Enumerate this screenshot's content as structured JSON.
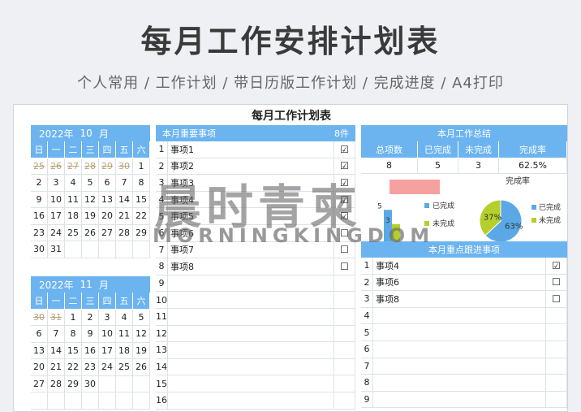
{
  "header": {
    "title": "每月工作安排计划表",
    "subtitle": "个人常用 / 工作计划 / 带日历版工作计划 / 完成进度 / A4打印"
  },
  "sheet": {
    "title": "每月工作计划表"
  },
  "weekdays": [
    "日",
    "一",
    "二",
    "三",
    "四",
    "五",
    "六"
  ],
  "calendars": [
    {
      "year": "2022年",
      "month": "10",
      "month_unit": "月",
      "weeks": [
        [
          {
            "d": "25",
            "p": true
          },
          {
            "d": "26",
            "p": true
          },
          {
            "d": "27",
            "p": true
          },
          {
            "d": "28",
            "p": true
          },
          {
            "d": "29",
            "p": true
          },
          {
            "d": "30",
            "p": true
          },
          {
            "d": "1"
          }
        ],
        [
          {
            "d": "2"
          },
          {
            "d": "3"
          },
          {
            "d": "4"
          },
          {
            "d": "5"
          },
          {
            "d": "6"
          },
          {
            "d": "7"
          },
          {
            "d": "8"
          }
        ],
        [
          {
            "d": "9"
          },
          {
            "d": "10"
          },
          {
            "d": "11"
          },
          {
            "d": "12"
          },
          {
            "d": "13"
          },
          {
            "d": "14"
          },
          {
            "d": "15"
          }
        ],
        [
          {
            "d": "16"
          },
          {
            "d": "17"
          },
          {
            "d": "18"
          },
          {
            "d": "19"
          },
          {
            "d": "20"
          },
          {
            "d": "21"
          },
          {
            "d": "22"
          }
        ],
        [
          {
            "d": "23"
          },
          {
            "d": "24"
          },
          {
            "d": "25"
          },
          {
            "d": "26"
          },
          {
            "d": "27"
          },
          {
            "d": "28"
          },
          {
            "d": "29"
          }
        ],
        [
          {
            "d": "30"
          },
          {
            "d": "31"
          },
          {
            "d": ""
          },
          {
            "d": ""
          },
          {
            "d": ""
          },
          {
            "d": ""
          },
          {
            "d": ""
          }
        ]
      ]
    },
    {
      "year": "2022年",
      "month": "11",
      "month_unit": "月",
      "weeks": [
        [
          {
            "d": "30",
            "p": true
          },
          {
            "d": "31",
            "p": true
          },
          {
            "d": "1"
          },
          {
            "d": "2"
          },
          {
            "d": "3"
          },
          {
            "d": "4"
          },
          {
            "d": "5"
          }
        ],
        [
          {
            "d": "6"
          },
          {
            "d": "7"
          },
          {
            "d": "8"
          },
          {
            "d": "9"
          },
          {
            "d": "10"
          },
          {
            "d": "11"
          },
          {
            "d": "12"
          }
        ],
        [
          {
            "d": "13"
          },
          {
            "d": "14"
          },
          {
            "d": "15"
          },
          {
            "d": "16"
          },
          {
            "d": "17"
          },
          {
            "d": "18"
          },
          {
            "d": "19"
          }
        ],
        [
          {
            "d": "20"
          },
          {
            "d": "21"
          },
          {
            "d": "22"
          },
          {
            "d": "23"
          },
          {
            "d": "24"
          },
          {
            "d": "25"
          },
          {
            "d": "26"
          }
        ],
        [
          {
            "d": "27"
          },
          {
            "d": "28"
          },
          {
            "d": "29"
          },
          {
            "d": "30"
          },
          {
            "d": ""
          },
          {
            "d": ""
          },
          {
            "d": ""
          }
        ],
        [
          {
            "d": ""
          },
          {
            "d": ""
          },
          {
            "d": ""
          },
          {
            "d": ""
          },
          {
            "d": ""
          },
          {
            "d": ""
          },
          {
            "d": ""
          }
        ]
      ]
    }
  ],
  "tasks": {
    "title": "本月重要事项",
    "count": "8件",
    "rows": [
      {
        "n": "1",
        "t": "事项1",
        "c": "☑"
      },
      {
        "n": "2",
        "t": "事项2",
        "c": "☑"
      },
      {
        "n": "3",
        "t": "事项3",
        "c": "☑"
      },
      {
        "n": "4",
        "t": "事项4",
        "c": "☑"
      },
      {
        "n": "5",
        "t": "事项5",
        "c": "☑"
      },
      {
        "n": "6",
        "t": "事项6",
        "c": "☐"
      },
      {
        "n": "7",
        "t": "事项7",
        "c": "☐"
      },
      {
        "n": "8",
        "t": "事项8",
        "c": "☐"
      },
      {
        "n": "9",
        "t": "",
        "c": ""
      },
      {
        "n": "10",
        "t": "",
        "c": ""
      },
      {
        "n": "11",
        "t": "",
        "c": ""
      },
      {
        "n": "12",
        "t": "",
        "c": ""
      },
      {
        "n": "13",
        "t": "",
        "c": ""
      },
      {
        "n": "14",
        "t": "",
        "c": ""
      },
      {
        "n": "15",
        "t": "",
        "c": ""
      },
      {
        "n": "16",
        "t": "",
        "c": ""
      }
    ]
  },
  "summary": {
    "title": "本月工作总结",
    "headers": [
      "总项数",
      "已完成",
      "未完成",
      "完成率"
    ],
    "values": [
      "8",
      "5",
      "3",
      "62.5%"
    ]
  },
  "chart_data": [
    {
      "type": "bar",
      "categories": [
        ""
      ],
      "series": [
        {
          "name": "已完成",
          "values": [
            5
          ]
        },
        {
          "name": "未完成",
          "values": [
            3
          ]
        }
      ],
      "data_labels": [
        "5",
        "3"
      ],
      "colors": [
        "#5aa9e6",
        "#b5cf2b"
      ],
      "legend": "right"
    },
    {
      "type": "pie",
      "title": "完成率",
      "labels": [
        "已完成",
        "未完成"
      ],
      "values": [
        63,
        37
      ],
      "data_labels": [
        "63%",
        "37%"
      ],
      "colors": [
        "#5aa9e6",
        "#b5cf2b"
      ],
      "legend": "right"
    }
  ],
  "followup": {
    "title": "本月重点跟进事项",
    "rows": [
      {
        "n": "1",
        "t": "事项4",
        "c": "☑"
      },
      {
        "n": "2",
        "t": "事项6",
        "c": "☐"
      },
      {
        "n": "3",
        "t": "事项8",
        "c": "☐"
      },
      {
        "n": "4",
        "t": "",
        "c": ""
      },
      {
        "n": "5",
        "t": "",
        "c": ""
      },
      {
        "n": "6",
        "t": "",
        "c": ""
      },
      {
        "n": "7",
        "t": "",
        "c": ""
      },
      {
        "n": "8",
        "t": "",
        "c": ""
      },
      {
        "n": "9",
        "t": "",
        "c": ""
      }
    ]
  },
  "watermark": {
    "cn": "晨时青柬",
    "en": "MORNINGKINGDOM"
  }
}
